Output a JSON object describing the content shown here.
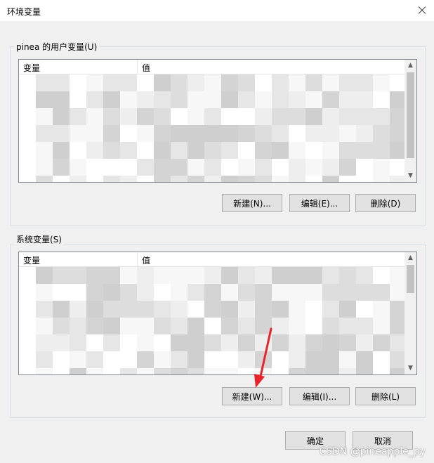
{
  "window": {
    "title": "环境变量"
  },
  "user_vars": {
    "group_label": "pinea 的用户变量(U)",
    "col_var": "变量",
    "col_val": "值",
    "btn_new": "新建(N)...",
    "btn_edit": "编辑(E)...",
    "btn_delete": "删除(D)"
  },
  "system_vars": {
    "group_label": "系统变量(S)",
    "col_var": "变量",
    "col_val": "值",
    "btn_new": "新建(W)...",
    "btn_edit": "编辑(I)...",
    "btn_delete": "删除(L)"
  },
  "footer": {
    "ok": "确定",
    "cancel": "取消"
  },
  "watermark": "CSDN @pineapple_py",
  "colors": {
    "annotation_arrow": "#e8242a",
    "blur_gray": "#d9d9d9"
  },
  "icons": {
    "close": "close-icon",
    "scroll_up": "scroll-up-arrow-icon",
    "scroll_down": "scroll-down-arrow-icon"
  }
}
